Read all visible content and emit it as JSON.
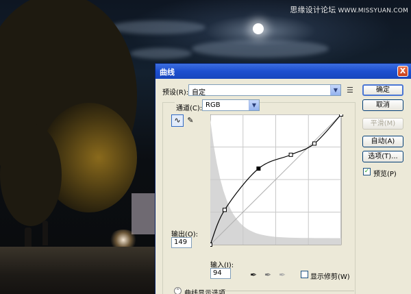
{
  "watermark": {
    "text": "思缘设计论坛",
    "url": "WWW.MISSYUAN.COM"
  },
  "dialog": {
    "title": "曲线",
    "close_glyph": "X",
    "preset_label": "预设(R):",
    "preset_value": "自定",
    "channel_label": "通道(C):",
    "channel_value": "RGB",
    "output_label": "输出(O):",
    "output_value": "149",
    "input_label": "输入(I):",
    "input_value": "94",
    "show_clipping_label": "显示修剪(W)",
    "show_clipping_checked": false,
    "curve_display_options_label": "曲线显示选项",
    "buttons": {
      "ok": "确定",
      "cancel": "取消",
      "smooth": "平滑(M)",
      "auto": "自动(A)",
      "options": "选项(T)..."
    },
    "preview_label": "预览(P)",
    "preview_checked": true,
    "icons": {
      "curve_tool": "curve-point-icon",
      "pencil_tool": "pencil-icon",
      "preset_menu": "menu-lines-icon",
      "black_eyedropper": "eyedropper-black-icon",
      "gray_eyedropper": "eyedropper-gray-icon",
      "white_eyedropper": "eyedropper-white-icon",
      "expand": "chevron-double-up-icon"
    }
  },
  "curve": {
    "input_range": [
      0,
      255
    ],
    "output_range": [
      0,
      255
    ],
    "control_points": [
      [
        0,
        0
      ],
      [
        28,
        68
      ],
      [
        94,
        149
      ],
      [
        157,
        176
      ],
      [
        203,
        198
      ],
      [
        255,
        255
      ]
    ],
    "selected_point": [
      94,
      149
    ],
    "histogram_profile": "dark-heavy"
  },
  "colors": {
    "title_bar": "#1d4fcf",
    "dialog_bg": "#ece9d8",
    "histogram": "#d6d6d6",
    "curve": "#000000"
  }
}
